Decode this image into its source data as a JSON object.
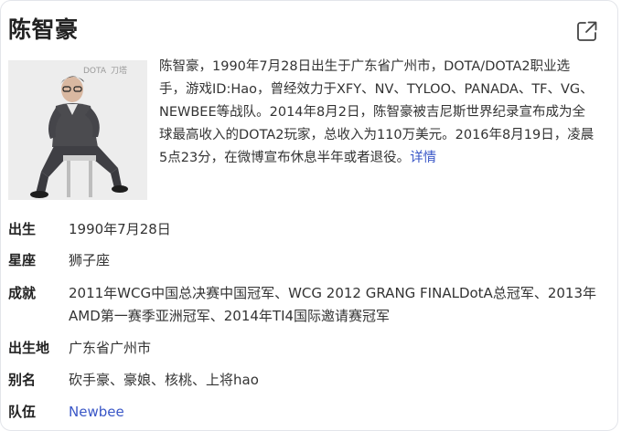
{
  "card": {
    "title": "陈智豪",
    "share_icon": "external-link-icon",
    "photo": {
      "subject": "person-seated-portrait",
      "caption_marks": [
        "DOTA",
        "刀塔"
      ]
    },
    "intro": {
      "text": "陈智豪，1990年7月28日出生于广东省广州市，DOTA/DOTA2职业选手，游戏ID:Hao，曾经效力于XFY、NV、TYLOO、PANADA、TF、VG、NEWBEE等战队。2014年8月2日，陈智豪被吉尼斯世界纪录宣布成为全球最高收入的DOTA2玩家，总收入为110万美元。2016年8月19日，凌晨5点23分，在微博宣布休息半年或者退役。",
      "more_link": "详情"
    },
    "facts": [
      {
        "label": "出生",
        "value": "1990年7月28日"
      },
      {
        "label": "星座",
        "value": "狮子座"
      },
      {
        "label": "成就",
        "value": "2011年WCG中国总决赛中国冠军、WCG 2012 GRANG FINALDotA总冠军、2013年AMD第一赛季亚洲冠军、2014年TI4国际邀请赛冠军"
      },
      {
        "label": "出生地",
        "value": "广东省广州市"
      },
      {
        "label": "别名",
        "value": "砍手豪、豪娘、核桃、上将hao"
      },
      {
        "label": "队伍",
        "value": "Newbee"
      }
    ]
  },
  "colors": {
    "link": "#3a57c7",
    "text": "#333333",
    "label": "#222222",
    "border": "#e3e5ea"
  }
}
